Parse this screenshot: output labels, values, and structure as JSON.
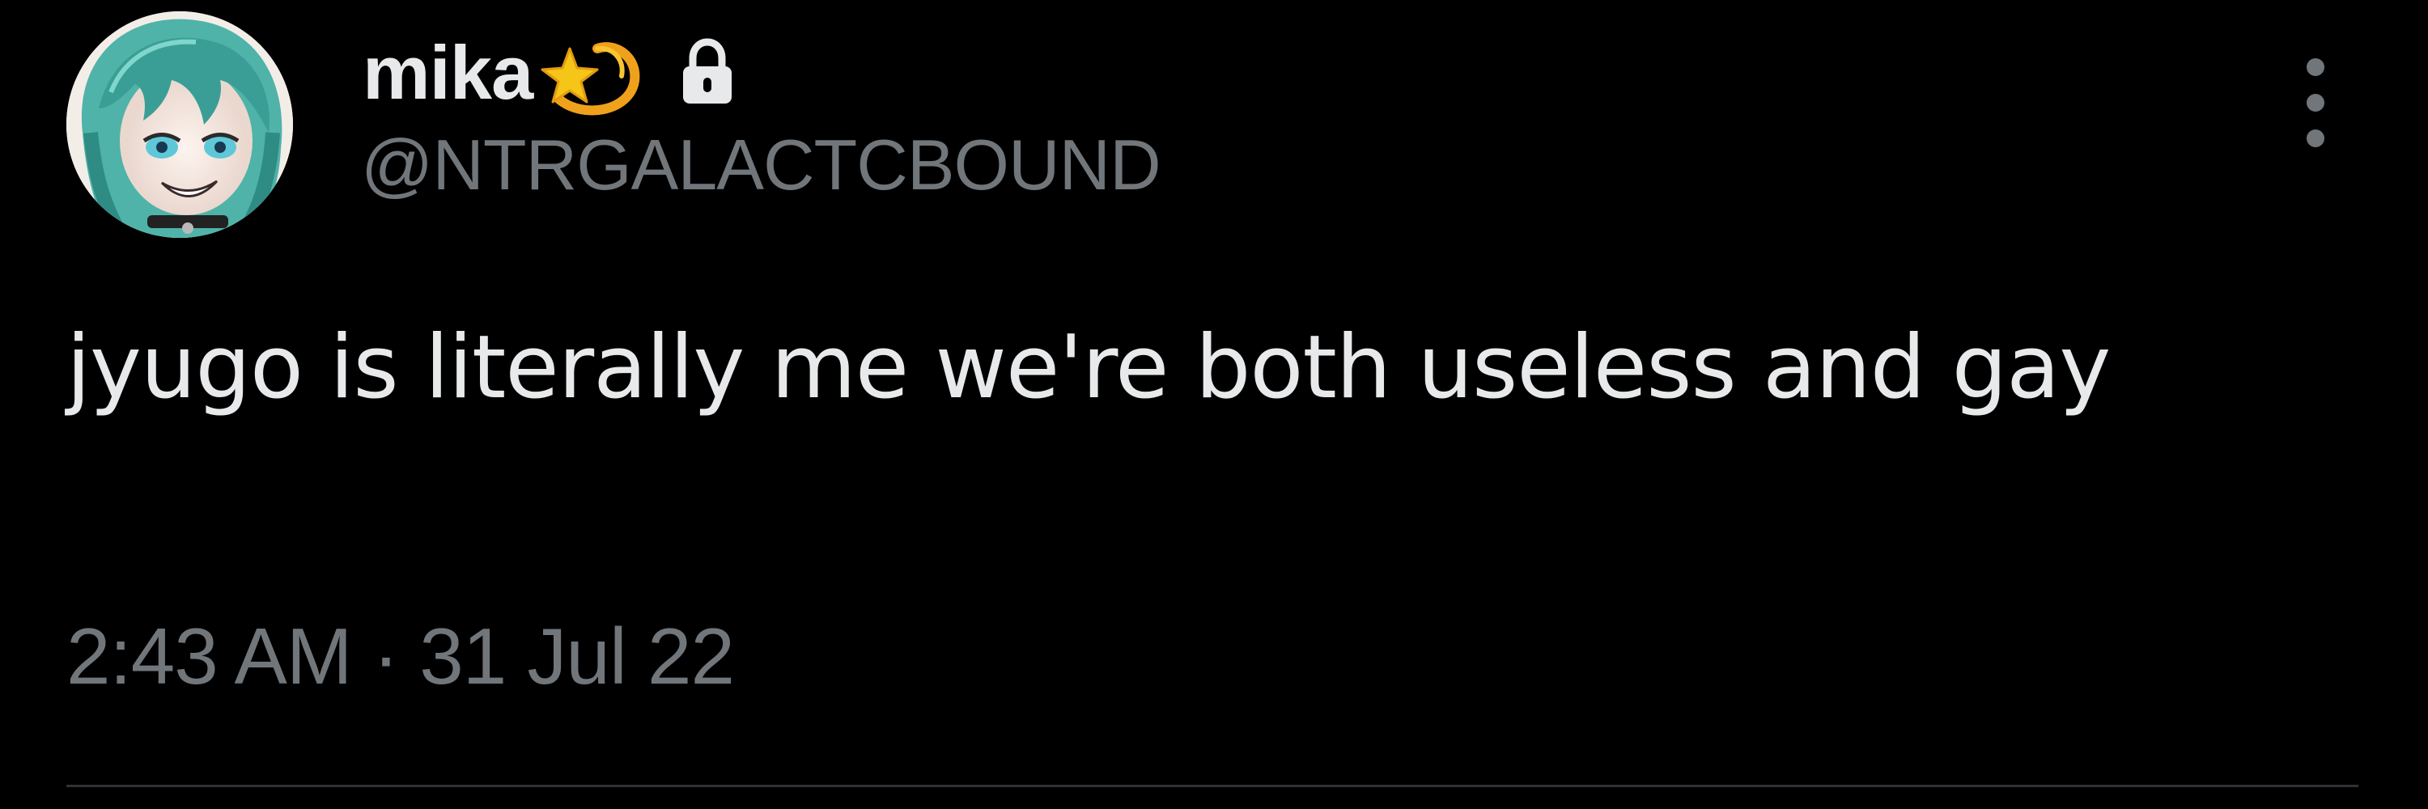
{
  "tweet": {
    "author": {
      "display_name": "mika",
      "handle": "@NTRGALACTCBOUND",
      "name_emoji": "dizzy-star-icon",
      "protected_icon": "lock-icon",
      "avatar": "avatar"
    },
    "text": "jyugo is literally me we're both useless and gay",
    "time": "2:43 AM",
    "separator": "·",
    "date": "31 Jul 22",
    "more_icon": "more-vertical-icon"
  },
  "colors": {
    "background": "#000000",
    "primary_text": "#e7e9ea",
    "secondary_text": "#71767b",
    "divider": "#2f3336",
    "emoji_star": "#f5c518",
    "emoji_trail": "#f0a11b"
  }
}
